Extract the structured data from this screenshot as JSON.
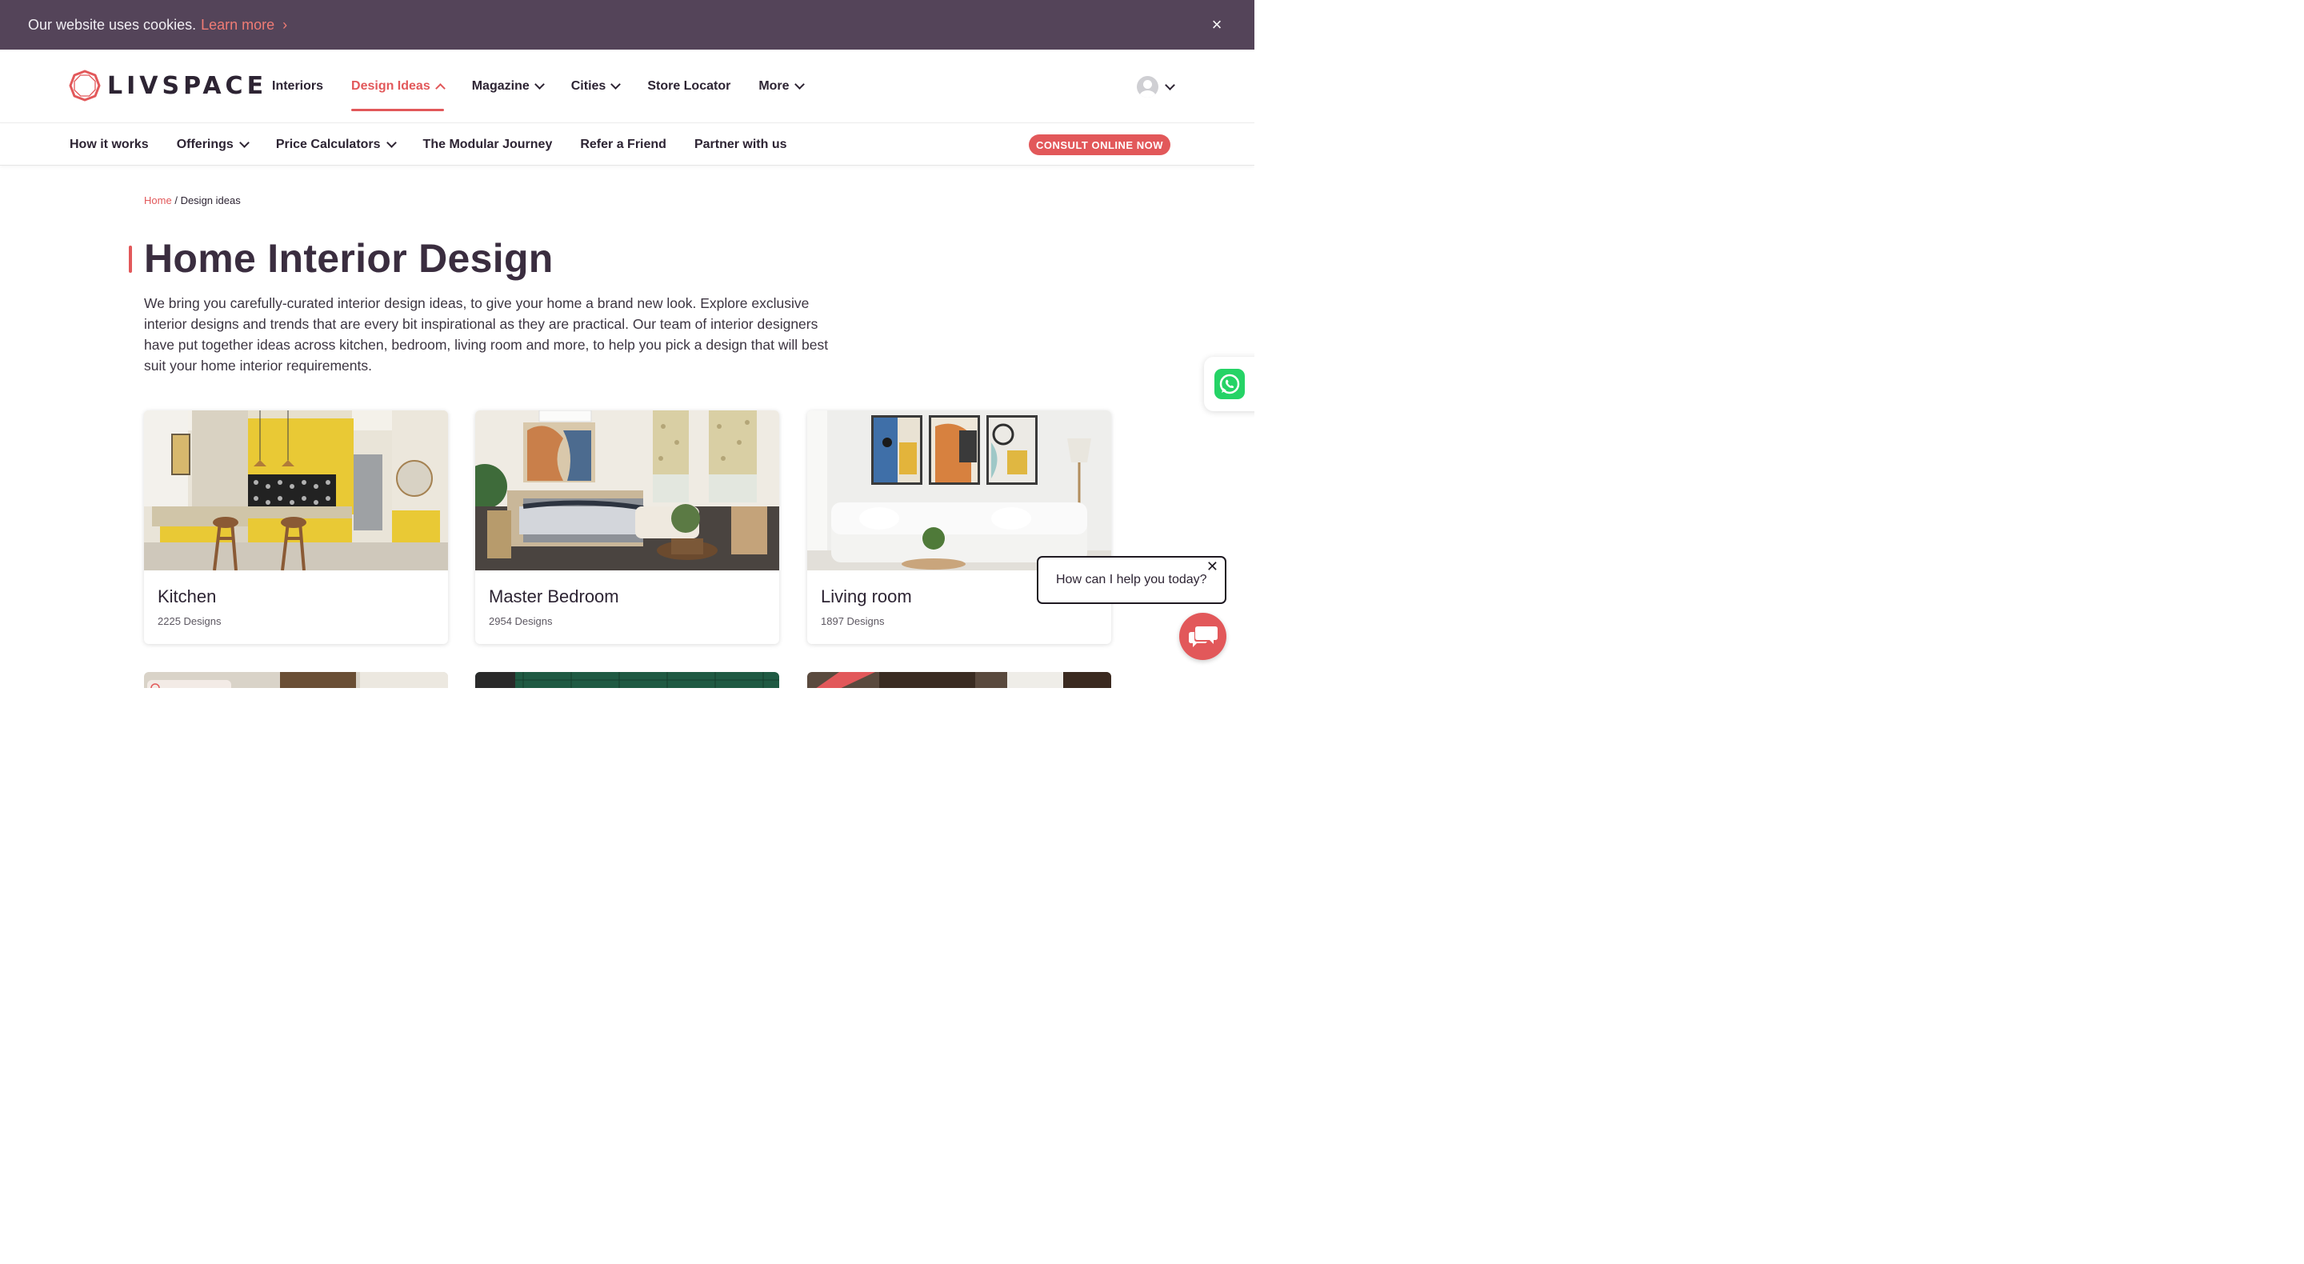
{
  "cookie": {
    "text": "Our website uses cookies.",
    "link": "Learn more",
    "close": "×"
  },
  "brand": {
    "name": "LIVSPACE"
  },
  "nav": {
    "items": [
      {
        "label": "Interiors",
        "dropdown": false,
        "active": false
      },
      {
        "label": "Design Ideas",
        "dropdown": true,
        "active": true
      },
      {
        "label": "Magazine",
        "dropdown": true,
        "active": false
      },
      {
        "label": "Cities",
        "dropdown": true,
        "active": false
      },
      {
        "label": "Store Locator",
        "dropdown": false,
        "active": false
      },
      {
        "label": "More",
        "dropdown": true,
        "active": false
      }
    ]
  },
  "subnav": {
    "items": [
      {
        "label": "How it works",
        "dropdown": false
      },
      {
        "label": "Offerings",
        "dropdown": true
      },
      {
        "label": "Price Calculators",
        "dropdown": true
      },
      {
        "label": "The Modular Journey",
        "dropdown": false
      },
      {
        "label": "Refer a Friend",
        "dropdown": false
      },
      {
        "label": "Partner with us",
        "dropdown": false
      }
    ],
    "cta": "CONSULT ONLINE NOW"
  },
  "breadcrumb": {
    "home": "Home",
    "separator": "/",
    "current": "Design ideas"
  },
  "page": {
    "title": "Home Interior Design",
    "intro": "We bring you carefully-curated interior design ideas, to give your home a brand new look. Explore exclusive interior designs and trends that are every bit inspirational as they are practical. Our team of interior designers have put together ideas across kitchen, bedroom, living room and more, to help you pick a design that will best suit your home interior requirements."
  },
  "cards": [
    {
      "title": "Kitchen",
      "count": "2225 Designs"
    },
    {
      "title": "Master Bedroom",
      "count": "2954 Designs"
    },
    {
      "title": "Living room",
      "count": "1897 Designs"
    }
  ],
  "chat": {
    "prompt": "How can I help you today?",
    "close": "✕"
  },
  "colors": {
    "accent": "#e2585a",
    "cookie_bg": "#544459",
    "text": "#2d2433",
    "whatsapp": "#25d366"
  }
}
